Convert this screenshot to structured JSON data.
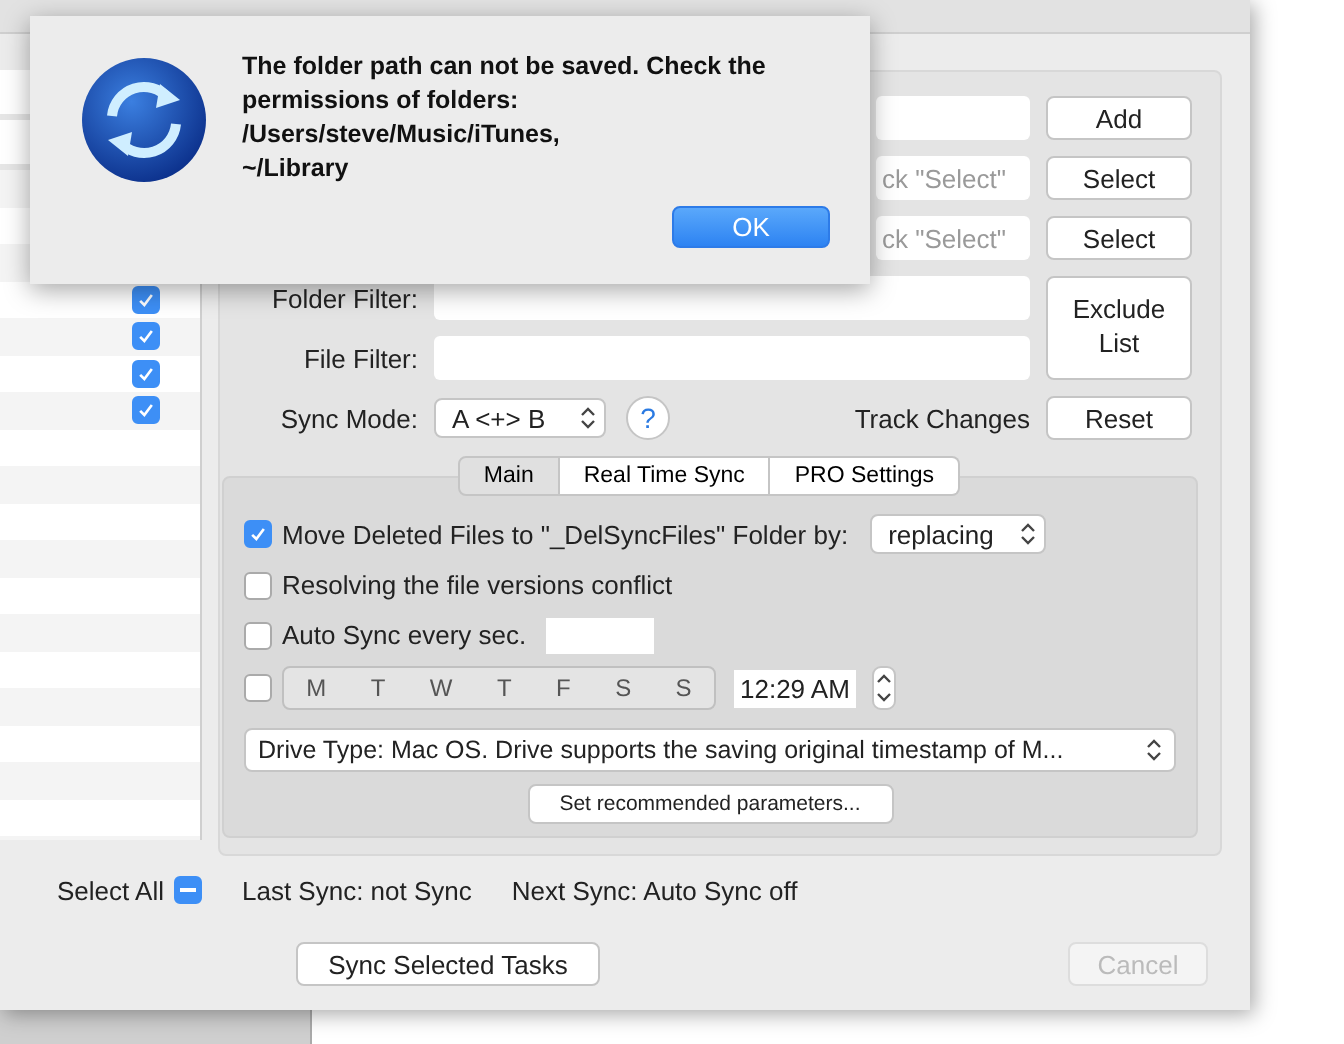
{
  "dialog": {
    "message_lines": [
      "The folder path can not be saved. Check the",
      "permissions of folders:",
      "/Users/steve/Music/iTunes,",
      "~/Library"
    ],
    "ok_button": "OK"
  },
  "task_list": {
    "rows": [
      {
        "checked": true
      },
      {
        "checked": true
      },
      {
        "checked": true
      },
      {
        "checked": true
      }
    ],
    "select_all": {
      "label": "Select All",
      "mixed": true
    }
  },
  "folders": [
    {
      "button": "Add"
    },
    {
      "placeholder": "ck \"Select\"",
      "button": "Select"
    },
    {
      "placeholder": "ck \"Select\"",
      "button": "Select"
    }
  ],
  "filters": [
    {
      "label": "Folder Filter:"
    },
    {
      "label": "File Filter:"
    }
  ],
  "exclude_button": "Exclude List",
  "sync_mode": {
    "label": "Sync Mode:",
    "value": "A <+> B",
    "help": "?",
    "track_label": "Track Changes",
    "reset_button": "Reset"
  },
  "tabs": [
    {
      "label": "Main",
      "selected": true
    },
    {
      "label": "Real Time Sync",
      "selected": false
    },
    {
      "label": "PRO Settings",
      "selected": false
    }
  ],
  "options": [
    {
      "label": "Move Deleted Files to \"_DelSyncFiles\" Folder by:",
      "checked": true,
      "select": "replacing"
    },
    {
      "label": "Resolving the file versions conflict",
      "checked": false
    },
    {
      "label": "Auto Sync every sec.",
      "checked": false,
      "field": true
    }
  ],
  "schedule": {
    "checked": false,
    "days": [
      {
        "label": "M",
        "selected": false
      },
      {
        "label": "T",
        "selected": false
      },
      {
        "label": "W",
        "selected": false
      },
      {
        "label": "T",
        "selected": false
      },
      {
        "label": "F",
        "selected": false
      },
      {
        "label": "S",
        "selected": false
      },
      {
        "label": "S",
        "selected": false
      }
    ],
    "time": "12:29 AM"
  },
  "drive_type": "Drive Type: Mac OS. Drive supports the saving original timestamp of M...",
  "recommend_button": "Set recommended parameters...",
  "status": {
    "last_sync": "Last Sync: not Sync",
    "next_sync": "Next Sync: Auto Sync off"
  },
  "footer": {
    "sync_button": "Sync Selected Tasks",
    "cancel_button": "Cancel",
    "cancel_disabled": true
  }
}
